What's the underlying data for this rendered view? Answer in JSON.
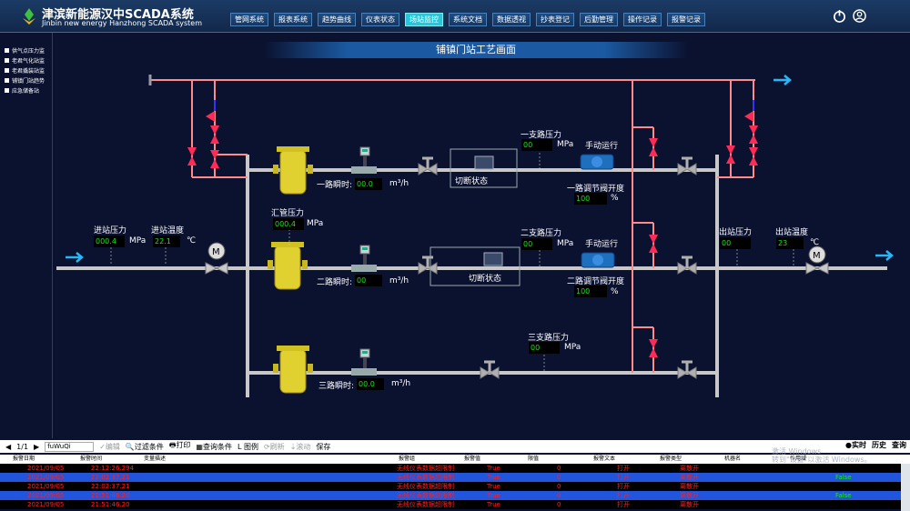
{
  "app": {
    "title": "津滨新能源汉中SCADA系统",
    "subtitle": "Jinbin new energy Hanzhong SCADA system"
  },
  "nav": [
    "管网系统",
    "报表系统",
    "趋势曲线",
    "仪表状态",
    "场站监控",
    "系统文档",
    "数据透视",
    "抄表登记",
    "后勤管理",
    "操作记录",
    "报警记录"
  ],
  "nav_active": 4,
  "sidebar": [
    "供气点压力监",
    "老君气化站监",
    "老君撬装站监",
    "铺镇门站趋势",
    "应急储备站"
  ],
  "page_title": "铺镇门站工艺画面",
  "labels": {
    "inlet_pressure": "进站压力",
    "inlet_temp": "进站温度",
    "outlet_pressure": "出站压力",
    "outlet_temp": "出站温度",
    "header_pressure": "汇管压力",
    "b1_pressure": "一支路压力",
    "b2_pressure": "二支路压力",
    "b3_pressure": "三支路压力",
    "flow1": "一路瞬时:",
    "flow2": "二路瞬时:",
    "flow3": "三路瞬时:",
    "manual1": "手动运行",
    "manual2": "手动运行",
    "cut1": "切断状态",
    "cut2": "切断状态",
    "valve1": "一路调节阀开度",
    "valve2": "二路调节阀开度",
    "mpa": "MPa",
    "m3h": "m³/h",
    "celsius": "℃",
    "pct": "%"
  },
  "values": {
    "inlet_pressure": "000.4",
    "inlet_temp": "22.1",
    "outlet_pressure": "00",
    "outlet_temp": "23",
    "header_pressure": "000.4",
    "b1_pressure": "00",
    "b2_pressure": "00",
    "b3_pressure": "00",
    "flow1": "00.0",
    "flow2": "00",
    "flow3": "00.0",
    "valve1": "100",
    "valve2": "100"
  },
  "toolbar": {
    "page": "1/1",
    "filter_value": "fuWuQi",
    "edit": "编辑",
    "filter": "过滤条件",
    "print": "打印",
    "query": "查询条件",
    "legend": "L 图例",
    "refresh": "刷新",
    "scroll": "滚动",
    "save": "保存",
    "realtime": "实时",
    "history": "历史",
    "query2": "查询"
  },
  "grid_columns": [
    "报警日期",
    "报警时间",
    "变量描述",
    "报警组",
    "报警值",
    "限值",
    "报警文本",
    "报警类型",
    "机器名",
    "",
    "作用域"
  ],
  "grid_rows": [
    {
      "date": "2021/09/05",
      "time": "22:12:26.294",
      "group": "无线仪表数据超限制",
      "value": "True",
      "limit": "0",
      "text": "打开",
      "type": "离散开",
      "scope": ""
    },
    {
      "date": "2021/09/05",
      "time": "22:02:37.21",
      "group": "无线仪表数据超限制",
      "value": "True",
      "limit": "0",
      "text": "打开",
      "type": "离散开",
      "scope": "False"
    },
    {
      "date": "2021/09/05",
      "time": "22:02:37.21",
      "group": "无线仪表数据超限制",
      "value": "True",
      "limit": "0",
      "text": "打开",
      "type": "离散开",
      "scope": ""
    },
    {
      "date": "2021/09/05",
      "time": "21:51:46.20",
      "group": "无线仪表数据超限制",
      "value": "True",
      "limit": "0",
      "text": "打开",
      "type": "离散开",
      "scope": "False"
    },
    {
      "date": "2021/09/05",
      "time": "21:51:46.20",
      "group": "无线仪表数据超限制",
      "value": "True",
      "limit": "0",
      "text": "打开",
      "type": "离散开",
      "scope": ""
    }
  ],
  "watermark": [
    "激活 Windows",
    "转到\"设置\"以激活 Windows。"
  ],
  "colors": {
    "accent": "#28c6d8",
    "pipe": "#c8c8c8",
    "bypass": "#ff8a8a",
    "value": "#1be41b",
    "alarm_text": "#ff2020",
    "row_blue": "#2255dd"
  },
  "icons": {
    "power": "power-icon",
    "user": "user-icon",
    "logo": "leaf-logo-icon"
  }
}
